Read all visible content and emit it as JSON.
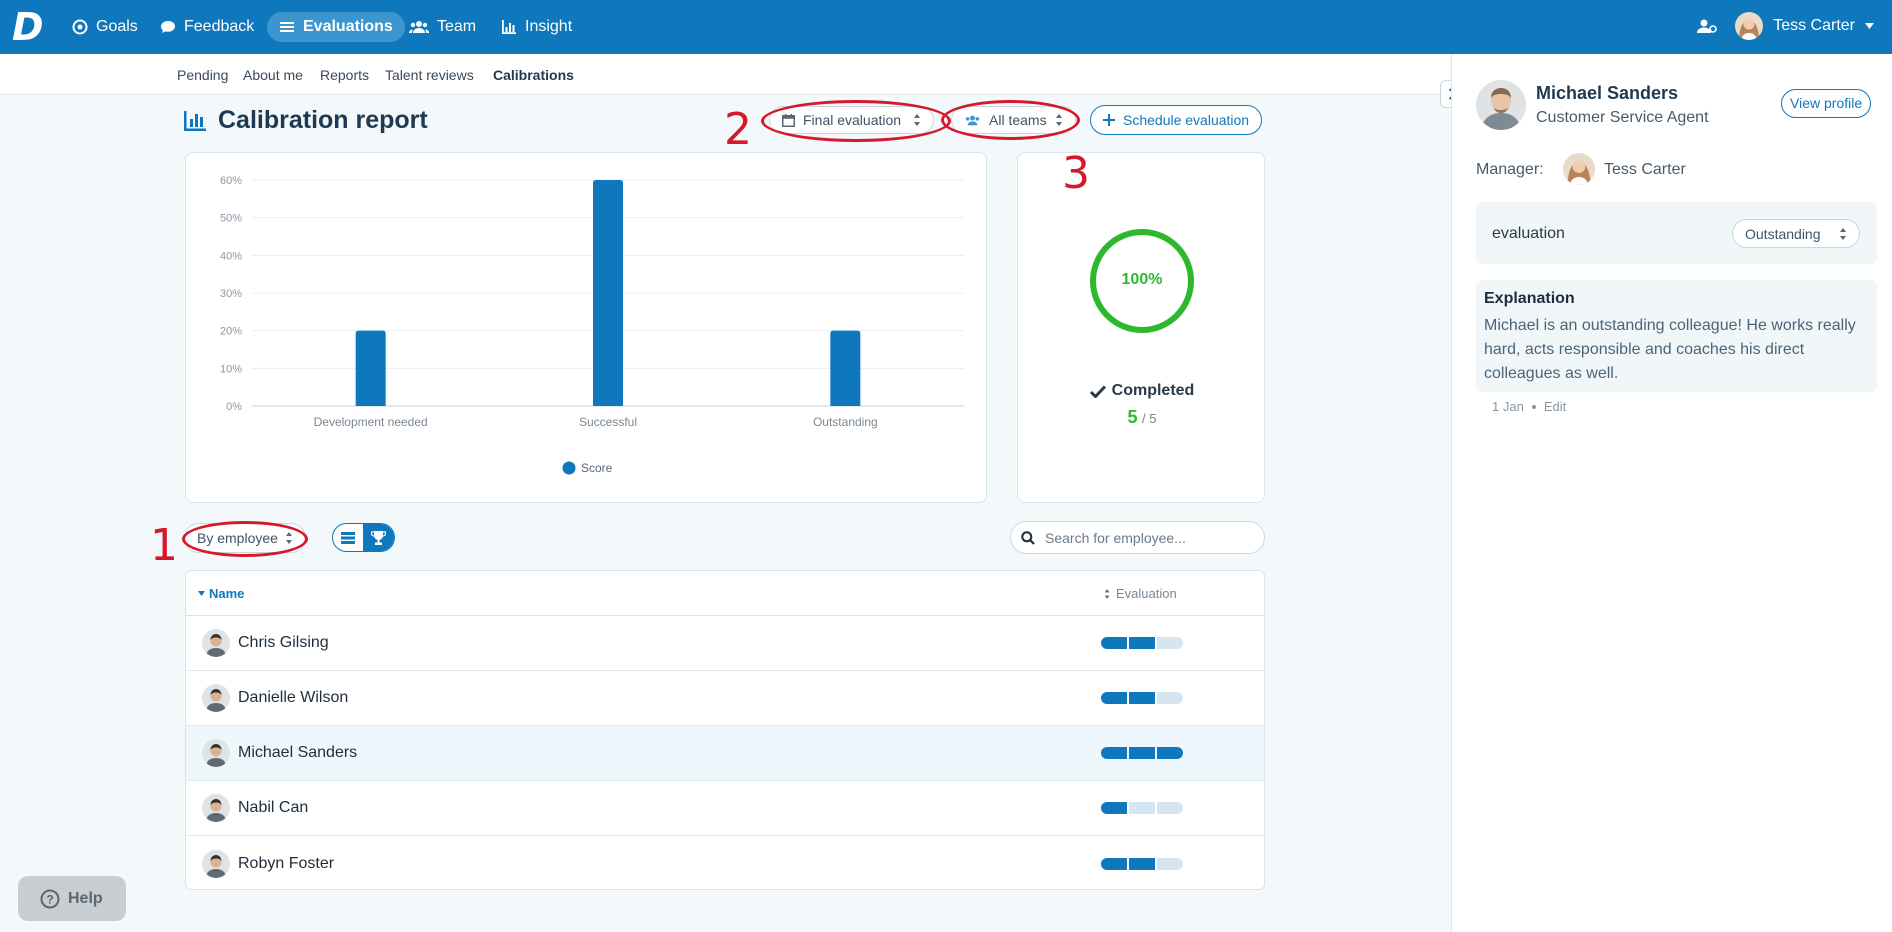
{
  "nav": {
    "logo": "D",
    "items": [
      {
        "label": "Goals",
        "icon": "target-icon"
      },
      {
        "label": "Feedback",
        "icon": "speech-bubble-icon"
      },
      {
        "label": "Evaluations",
        "icon": "list-icon"
      },
      {
        "label": "Team",
        "icon": "users-icon"
      },
      {
        "label": "Insight",
        "icon": "bar-chart-icon"
      }
    ],
    "user_name": "Tess Carter"
  },
  "subnav": [
    "Pending",
    "About me",
    "Reports",
    "Talent reviews",
    "Calibrations"
  ],
  "page": {
    "title": "Calibration report",
    "filter_evaluation": "Final evaluation",
    "filter_teams": "All teams",
    "schedule_label": "Schedule evaluation"
  },
  "chart_data": {
    "type": "bar",
    "categories": [
      "Development needed",
      "Successful",
      "Outstanding"
    ],
    "series": [
      {
        "name": "Score",
        "values": [
          20,
          60,
          20
        ]
      }
    ],
    "yticks": [
      "0%",
      "10%",
      "20%",
      "30%",
      "40%",
      "50%",
      "60%"
    ],
    "ylim": [
      0,
      60
    ],
    "legend": "bottom-center",
    "color": "#0f78bd",
    "grid": true
  },
  "completion": {
    "percent_label": "100%",
    "percent": 100,
    "status": "Completed",
    "done": "5",
    "total": "/ 5"
  },
  "controls": {
    "group_by": "By employee",
    "search_placeholder": "Search for employee..."
  },
  "table": {
    "col_name": "Name",
    "col_eval": "Evaluation",
    "rows": [
      {
        "name": "Chris Gilsing",
        "level": 2,
        "selected": false
      },
      {
        "name": "Danielle Wilson",
        "level": 2,
        "selected": false
      },
      {
        "name": "Michael Sanders",
        "level": 3,
        "selected": true
      },
      {
        "name": "Nabil Can",
        "level": 1,
        "selected": false
      },
      {
        "name": "Robyn Foster",
        "level": 2,
        "selected": false
      }
    ]
  },
  "detail": {
    "name": "Michael Sanders",
    "role": "Customer Service Agent",
    "view_profile": "View profile",
    "manager_label": "Manager:",
    "manager_name": "Tess Carter",
    "evaluation_label": "evaluation",
    "evaluation_value": "Outstanding",
    "explanation_title": "Explanation",
    "explanation_text": "Michael is an outstanding colleague! He works really hard, acts responsible and coaches his direct colleagues as well.",
    "date": "1 Jan",
    "edit": "Edit"
  },
  "annotations": [
    "1",
    "2",
    "3"
  ],
  "help_label": "Help"
}
